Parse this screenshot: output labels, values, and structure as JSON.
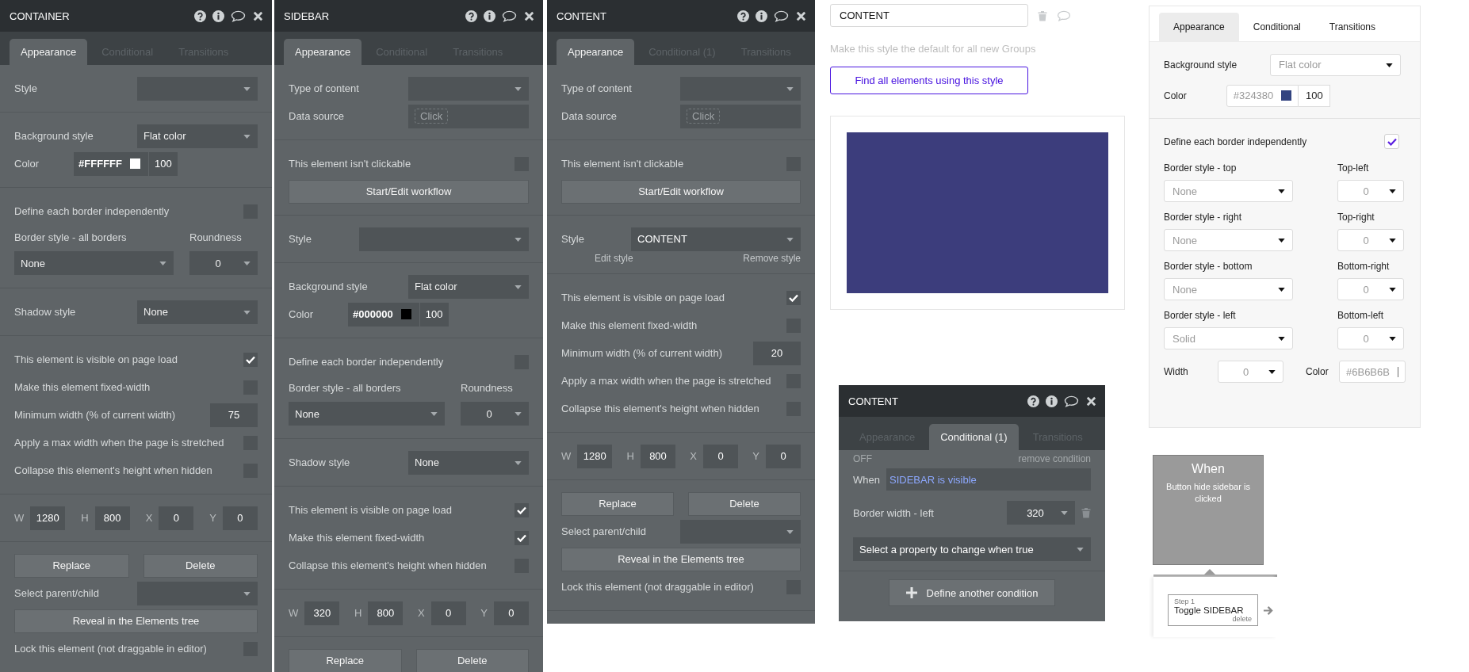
{
  "panels": [
    {
      "title": "CONTAINER",
      "tabs": [
        {
          "label": "Appearance",
          "selected": true
        },
        {
          "label": "Conditional",
          "selected": false
        },
        {
          "label": "Transitions",
          "selected": false
        }
      ],
      "sections": [
        [
          {
            "kind": "select",
            "label": "Style"
          }
        ],
        [
          {
            "kind": "select",
            "label": "Background style",
            "value": "Flat color"
          },
          {
            "kind": "color",
            "label": "Color",
            "hex": "#FFFFFF",
            "opacity": "100"
          }
        ],
        [
          {
            "kind": "check",
            "label": "Define each border independently",
            "checked": false
          },
          {
            "kind": "border",
            "label": "Border style - all borders",
            "corner_label": "Roundness",
            "value": "None",
            "corner_value": "0"
          }
        ],
        [
          {
            "kind": "select",
            "label": "Shadow style",
            "value": "None"
          }
        ],
        [
          {
            "kind": "check",
            "label": "This element is visible on page load",
            "checked": true
          },
          {
            "kind": "check",
            "label": "Make this element fixed-width",
            "checked": false
          },
          {
            "kind": "number",
            "label": "Minimum width (% of current width)",
            "value": "75"
          },
          {
            "kind": "check",
            "label": "Apply a max width when the page is stretched",
            "checked": false
          },
          {
            "kind": "check",
            "label": "Collapse this element's height when hidden",
            "checked": false
          }
        ],
        [
          {
            "kind": "dims",
            "items": [
              {
                "label": "W",
                "value": "1280"
              },
              {
                "label": "H",
                "value": "800"
              },
              {
                "label": "X",
                "value": "0"
              },
              {
                "label": "Y",
                "value": "0"
              }
            ]
          }
        ],
        [
          {
            "kind": "buttons",
            "labels": [
              "Replace",
              "Delete"
            ]
          },
          {
            "kind": "select",
            "label": "Select parent/child"
          },
          {
            "kind": "button",
            "label": "Reveal in the Elements tree"
          },
          {
            "kind": "check",
            "label": "Lock this element (not draggable in editor)",
            "checked": false
          }
        ]
      ]
    },
    {
      "title": "SIDEBAR",
      "tabs": [
        {
          "label": "Appearance",
          "selected": true
        },
        {
          "label": "Conditional",
          "selected": false
        },
        {
          "label": "Transitions",
          "selected": false
        }
      ],
      "sections": [
        [
          {
            "kind": "select",
            "label": "Type of content"
          },
          {
            "kind": "chip",
            "label": "Data source",
            "placeholder": "Click"
          }
        ],
        [
          {
            "kind": "check",
            "label": "This element isn't clickable",
            "checked": false
          },
          {
            "kind": "button",
            "label": "Start/Edit workflow"
          }
        ],
        [
          {
            "kind": "style",
            "label": "Style"
          }
        ],
        [
          {
            "kind": "select",
            "label": "Background style",
            "value": "Flat color"
          },
          {
            "kind": "color",
            "label": "Color",
            "hex": "#000000",
            "opacity": "100"
          }
        ],
        [
          {
            "kind": "check",
            "label": "Define each border independently",
            "checked": false
          },
          {
            "kind": "border",
            "label": "Border style - all borders",
            "corner_label": "Roundness",
            "value": "None",
            "corner_value": "0"
          }
        ],
        [
          {
            "kind": "select",
            "label": "Shadow style",
            "value": "None"
          }
        ],
        [
          {
            "kind": "check",
            "label": "This element is visible on page load",
            "checked": true
          },
          {
            "kind": "check",
            "label": "Make this element fixed-width",
            "checked": true
          },
          {
            "kind": "check",
            "label": "Collapse this element's height when hidden",
            "checked": false
          }
        ],
        [
          {
            "kind": "dims",
            "items": [
              {
                "label": "W",
                "value": "320"
              },
              {
                "label": "H",
                "value": "800"
              },
              {
                "label": "X",
                "value": "0"
              },
              {
                "label": "Y",
                "value": "0"
              }
            ]
          }
        ],
        [
          {
            "kind": "buttons",
            "labels": [
              "Replace",
              "Delete"
            ]
          }
        ]
      ]
    },
    {
      "title": "CONTENT",
      "tabs": [
        {
          "label": "Appearance",
          "selected": true
        },
        {
          "label": "Conditional (1)",
          "selected": false
        },
        {
          "label": "Transitions",
          "selected": false
        }
      ],
      "sections": [
        [
          {
            "kind": "select",
            "label": "Type of content"
          },
          {
            "kind": "chip",
            "label": "Data source",
            "placeholder": "Click"
          }
        ],
        [
          {
            "kind": "check",
            "label": "This element isn't clickable",
            "checked": false
          },
          {
            "kind": "button",
            "label": "Start/Edit workflow"
          }
        ],
        [
          {
            "kind": "style",
            "label": "Style",
            "value": "CONTENT",
            "links": [
              "Edit style",
              "Remove style"
            ]
          }
        ],
        [
          {
            "kind": "check",
            "label": "This element is visible on page load",
            "checked": true
          },
          {
            "kind": "check",
            "label": "Make this element fixed-width",
            "checked": false
          },
          {
            "kind": "number",
            "label": "Minimum width (% of current width)",
            "value": "20"
          },
          {
            "kind": "check",
            "label": "Apply a max width when the page is stretched",
            "checked": false
          },
          {
            "kind": "check",
            "label": "Collapse this element's height when hidden",
            "checked": false
          }
        ],
        [
          {
            "kind": "dims",
            "items": [
              {
                "label": "W",
                "value": "1280"
              },
              {
                "label": "H",
                "value": "800"
              },
              {
                "label": "X",
                "value": "0"
              },
              {
                "label": "Y",
                "value": "0"
              }
            ]
          }
        ],
        [
          {
            "kind": "buttons",
            "labels": [
              "Replace",
              "Delete"
            ]
          },
          {
            "kind": "select",
            "label": "Select parent/child"
          },
          {
            "kind": "button",
            "label": "Reveal in the Elements tree"
          },
          {
            "kind": "check",
            "label": "Lock this element (not draggable in editor)",
            "checked": false
          }
        ]
      ]
    }
  ],
  "style_editor": {
    "name": "CONTENT",
    "default_note": "Make this style the default for all new Groups",
    "find_button": "Find all elements using this style"
  },
  "conditional_panel": {
    "title": "CONTENT",
    "tabs": [
      {
        "label": "Appearance",
        "selected": false
      },
      {
        "label": "Conditional (1)",
        "selected": true
      },
      {
        "label": "Transitions",
        "selected": false
      }
    ],
    "status": "OFF",
    "remove_link": "remove condition",
    "when_label": "When",
    "condition": "SIDEBAR is visible",
    "property_label": "Border width - left",
    "property_value": "320",
    "property_select": "Select a property to change when true",
    "add_button": "Define another condition"
  },
  "style_panel": {
    "tabs": [
      {
        "label": "Appearance",
        "selected": true
      },
      {
        "label": "Conditional",
        "selected": false
      },
      {
        "label": "Transitions",
        "selected": false
      }
    ],
    "background_label": "Background style",
    "background_value": "Flat color",
    "color_label": "Color",
    "color_hex": "#324380",
    "opacity": "100",
    "independent_label": "Define each border independently",
    "independent_checked": true,
    "borders": [
      {
        "label": "Border style - top",
        "value": "None",
        "corner_label": "Top-left",
        "corner_value": "0"
      },
      {
        "label": "Border style - right",
        "value": "None",
        "corner_label": "Top-right",
        "corner_value": "0"
      },
      {
        "label": "Border style - bottom",
        "value": "None",
        "corner_label": "Bottom-right",
        "corner_value": "0"
      },
      {
        "label": "Border style - left",
        "value": "Solid",
        "corner_label": "Bottom-left",
        "corner_value": "0"
      }
    ],
    "width_label": "Width",
    "width_value": "0",
    "border_color_label": "Color",
    "border_color_hex": "#6B6B6B"
  },
  "workflow": {
    "event_title": "When",
    "event_text": "Button hide sidebar is clicked",
    "step_label": "Step 1",
    "step_action": "Toggle SIDEBAR",
    "delete_link": "delete"
  }
}
